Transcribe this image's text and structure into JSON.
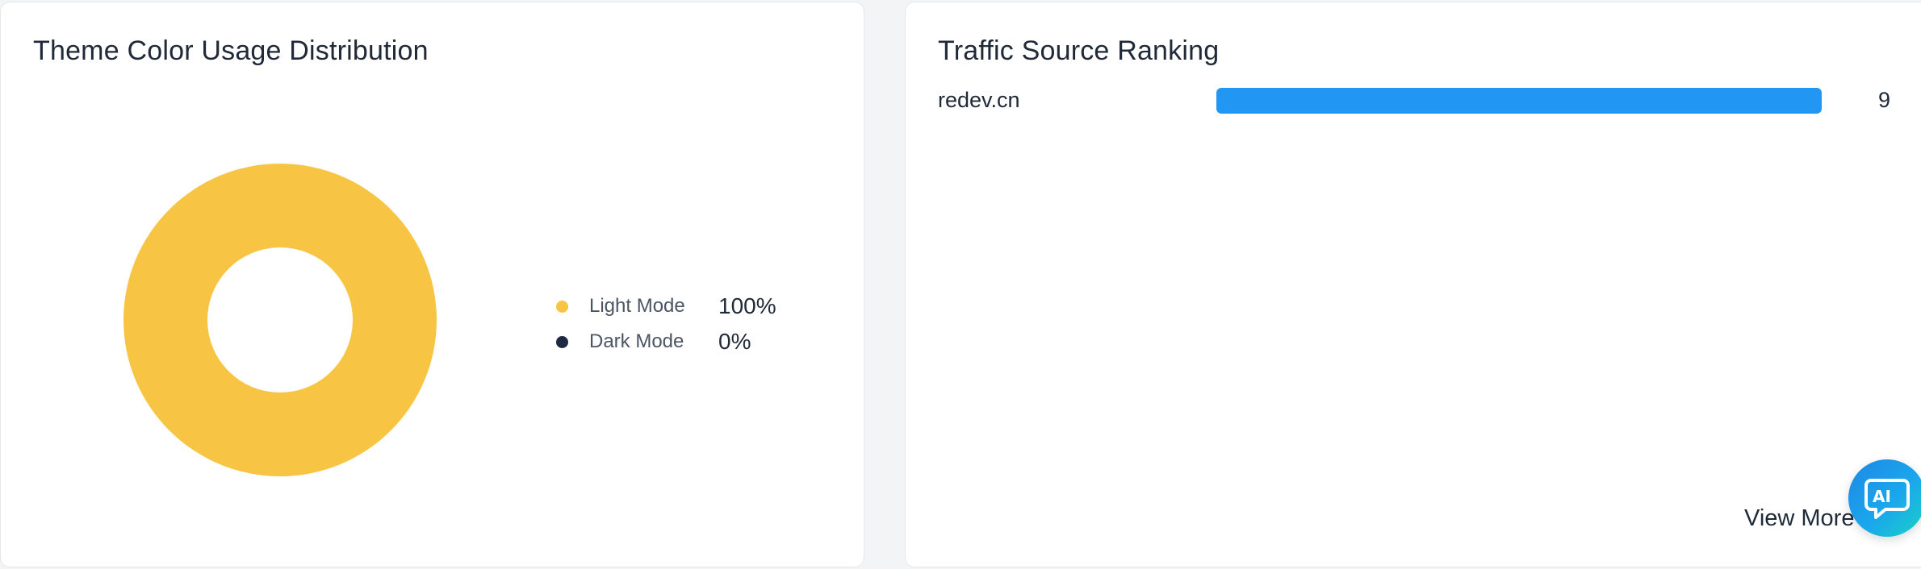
{
  "theme_panel": {
    "title": "Theme Color Usage Distribution",
    "legend": [
      {
        "label": "Light Mode",
        "value": "100%",
        "color": "#f7c443"
      },
      {
        "label": "Dark Mode",
        "value": "0%",
        "color": "#1e2a44"
      }
    ]
  },
  "chart_data": {
    "type": "pie",
    "categories": [
      "Light Mode",
      "Dark Mode"
    ],
    "values": [
      100,
      0
    ],
    "colors": [
      "#f7c443",
      "#1e2a44"
    ],
    "title": "Theme Color Usage Distribution"
  },
  "traffic_panel": {
    "title": "Traffic Source Ranking",
    "items": [
      {
        "name": "redev.cn",
        "value": "9",
        "fraction": 1.0,
        "bar_color": "#2196f3"
      }
    ],
    "view_more_label": "View More"
  },
  "ai_button": {
    "label": "AI",
    "icon": "chat-bubble-ai-icon"
  }
}
